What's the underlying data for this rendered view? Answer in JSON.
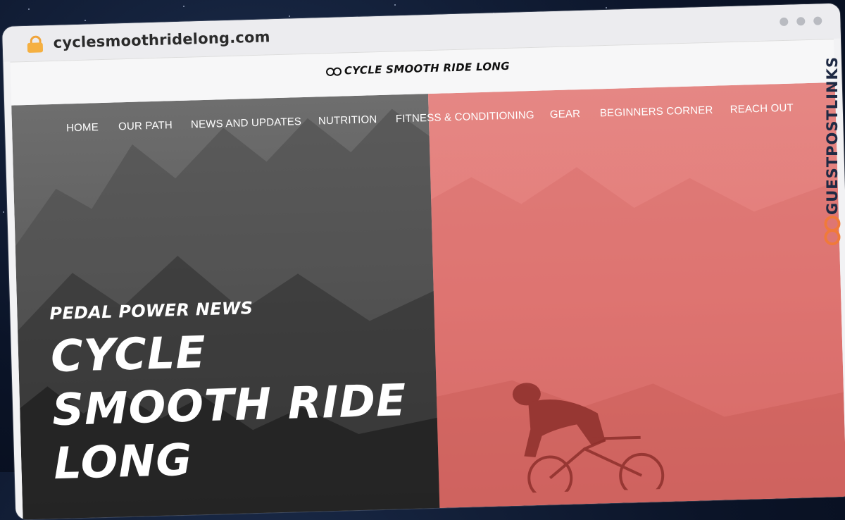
{
  "browser": {
    "url": "cyclesmoothridelong.com",
    "lock_icon": "lock-icon",
    "window_dots": [
      "dot",
      "dot",
      "dot"
    ]
  },
  "site": {
    "logo_text": "CYCLE SMOOTH RIDE LONG",
    "logo_icon": "bicycle-icon"
  },
  "nav": {
    "items": [
      {
        "label": "HOME"
      },
      {
        "label": "OUR PATH"
      },
      {
        "label": "NEWS AND UPDATES"
      },
      {
        "label": "NUTRITION"
      },
      {
        "label": "FITNESS & CONDITIONING"
      },
      {
        "label": "GEAR"
      },
      {
        "label": "BEGINNERS CORNER"
      },
      {
        "label": "REACH OUT"
      }
    ]
  },
  "hero": {
    "kicker": "PEDAL POWER NEWS",
    "headline_lines": [
      "CYCLE",
      "SMOOTH RIDE",
      "LONG"
    ],
    "colors": {
      "left": "#5e5e5e",
      "right": "#e47c79"
    }
  },
  "watermark": {
    "text": "GUESTPOSTLINKS",
    "icon": "chain-link-icon",
    "accent": "#f07a3a"
  }
}
